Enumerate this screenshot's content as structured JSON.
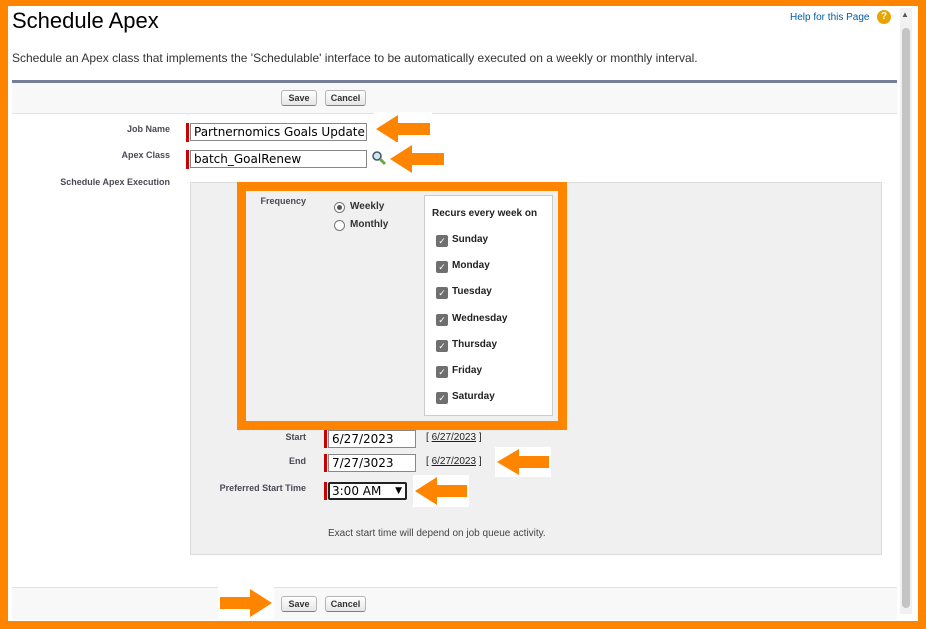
{
  "page": {
    "title": "Schedule Apex",
    "help_link": "Help for this Page",
    "help_icon": "?",
    "description": "Schedule an Apex class that implements the 'Schedulable' interface to be automatically executed on a weekly or monthly interval."
  },
  "buttons": {
    "save": "Save",
    "cancel": "Cancel"
  },
  "form": {
    "job_name_label": "Job Name",
    "job_name_value": "Partnernomics Goals Update",
    "apex_class_label": "Apex Class",
    "apex_class_value": "batch_GoalRenew",
    "execution_label": "Schedule Apex Execution",
    "frequency_label": "Frequency",
    "frequency_options": [
      {
        "label": "Weekly",
        "selected": true
      },
      {
        "label": "Monthly",
        "selected": false
      }
    ],
    "recurs_title": "Recurs every week on",
    "days": [
      {
        "label": "Sunday",
        "checked": true
      },
      {
        "label": "Monday",
        "checked": true
      },
      {
        "label": "Tuesday",
        "checked": true
      },
      {
        "label": "Wednesday",
        "checked": true
      },
      {
        "label": "Thursday",
        "checked": true
      },
      {
        "label": "Friday",
        "checked": true
      },
      {
        "label": "Saturday",
        "checked": true
      }
    ],
    "start_label": "Start",
    "start_value": "6/27/2023",
    "start_link": "6/27/2023",
    "end_label": "End",
    "end_value": "7/27/3023",
    "end_link": "6/27/2023",
    "preferred_time_label": "Preferred Start Time",
    "preferred_time_value": "3:00 AM",
    "note": "Exact start time will depend on job queue activity."
  },
  "colors": {
    "annotation": "#ff8400",
    "required": "#cc0000",
    "link": "#015ba7"
  }
}
